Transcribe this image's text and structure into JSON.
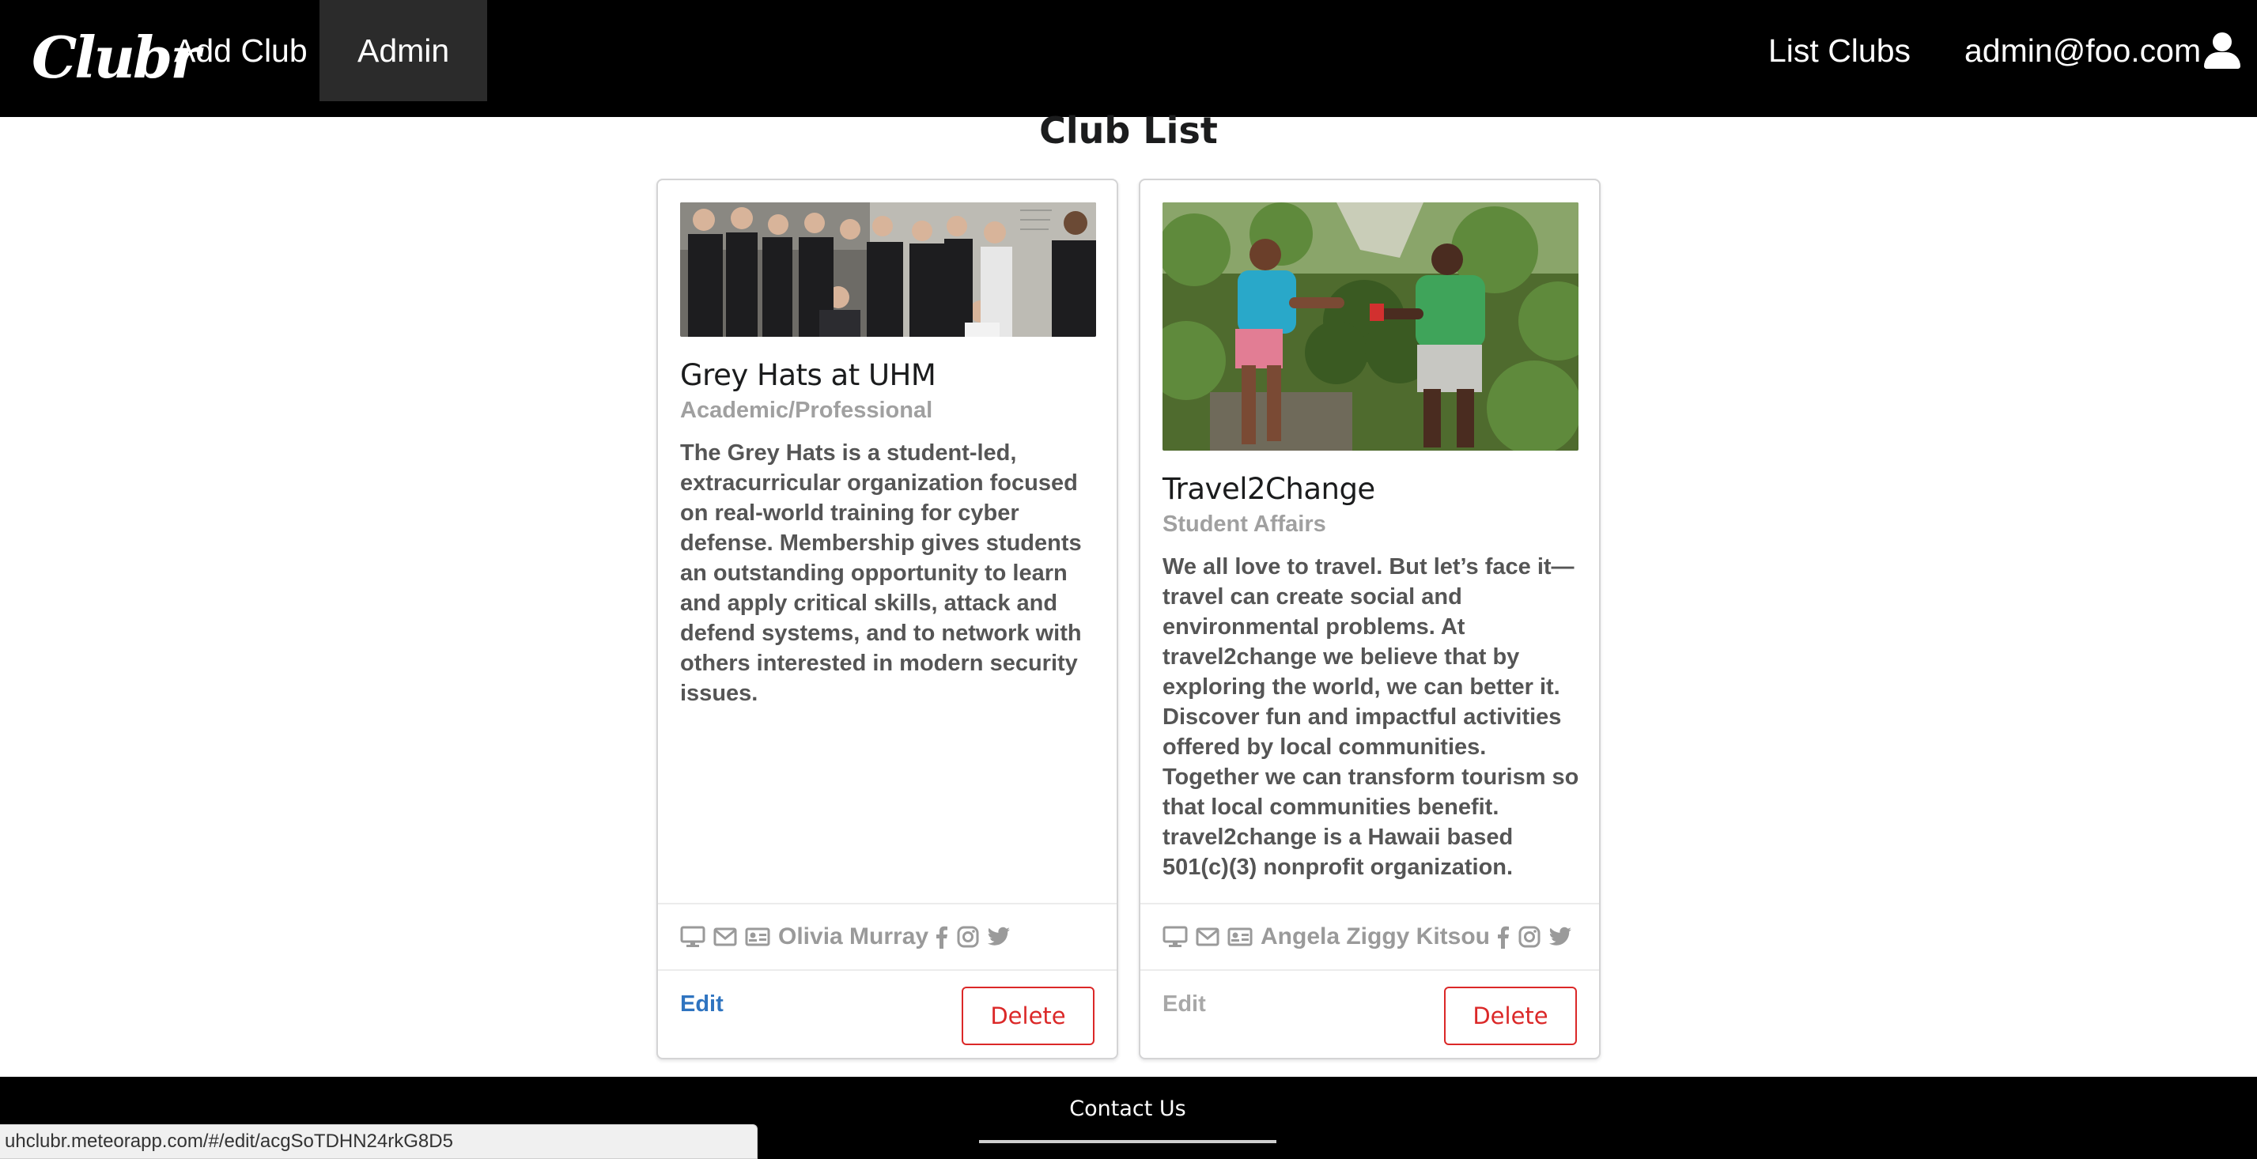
{
  "navbar": {
    "logo_text": "Clubr",
    "add_club": "Add Club",
    "admin": "Admin",
    "list_clubs": "List Clubs",
    "user_email": "admin@foo.com",
    "user_icon": "user-icon"
  },
  "page": {
    "title": "Club List"
  },
  "clubs": [
    {
      "name": "Grey Hats at UHM",
      "category": "Academic/Professional",
      "description": "The Grey Hats is a student-led, extracurricular organization focused on real-world training for cyber defense. Membership gives students an outstanding opportunity to learn and apply critical skills, attack and defend systems, and to network with others interested in modern security issues.",
      "contact": "Olivia Murray",
      "icons": [
        "desktop-icon",
        "envelope-icon",
        "id-card-icon",
        "facebook-icon",
        "instagram-icon",
        "twitter-icon"
      ],
      "edit_label": "Edit",
      "delete_label": "Delete"
    },
    {
      "name": "Travel2Change",
      "category": "Student Affairs",
      "description": "We all love to travel. But let’s face it—travel can create social and environmental problems. At travel2change we believe that by exploring the world, we can better it. Discover fun and impactful activities offered by local communities. Together we can transform tourism so that local communities benefit. travel2change is a Hawaii based 501(c)(3) nonprofit organization.",
      "contact": "Angela Ziggy Kitsou",
      "icons": [
        "desktop-icon",
        "envelope-icon",
        "id-card-icon",
        "facebook-icon",
        "instagram-icon",
        "twitter-icon"
      ],
      "edit_label": "Edit",
      "delete_label": "Delete"
    }
  ],
  "footer": {
    "contact_us": "Contact Us"
  },
  "status_bar": {
    "url": "uhclubr.meteorapp.com/#/edit/acgSoTDHN24rkG8D5"
  },
  "colors": {
    "navbar": "#000000",
    "edit_link": "#2f74c0",
    "delete": "#db2828",
    "muted": "#9a9a9a"
  }
}
